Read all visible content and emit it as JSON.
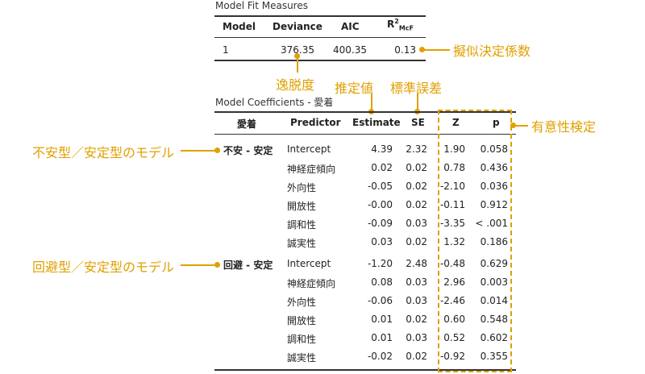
{
  "fit": {
    "title": "Model Fit Measures",
    "headers": {
      "model": "Model",
      "deviance": "Deviance",
      "aic": "AIC",
      "r2": "R",
      "r2_sup": "2",
      "r2_sub": "McF"
    },
    "row": {
      "model": "1",
      "deviance": "376.35",
      "aic": "400.35",
      "r2": "0.13"
    }
  },
  "coef": {
    "title": "Model Coefficients - 愛着",
    "headers": {
      "group": "愛着",
      "predictor": "Predictor",
      "estimate": "Estimate",
      "se": "SE",
      "z": "Z",
      "p": "p"
    },
    "groups": [
      {
        "label": "不安 - 安定",
        "rows": [
          {
            "predictor": "Intercept",
            "estimate": "4.39",
            "se": "2.32",
            "z": "1.90",
            "p": "0.058"
          },
          {
            "predictor": "神経症傾向",
            "estimate": "0.02",
            "se": "0.02",
            "z": "0.78",
            "p": "0.436"
          },
          {
            "predictor": "外向性",
            "estimate": "-0.05",
            "se": "0.02",
            "z": "-2.10",
            "p": "0.036"
          },
          {
            "predictor": "開放性",
            "estimate": "-0.00",
            "se": "0.02",
            "z": "-0.11",
            "p": "0.912"
          },
          {
            "predictor": "調和性",
            "estimate": "-0.09",
            "se": "0.03",
            "z": "-3.35",
            "p": "< .001"
          },
          {
            "predictor": "誠実性",
            "estimate": "0.03",
            "se": "0.02",
            "z": "1.32",
            "p": "0.186"
          }
        ]
      },
      {
        "label": "回避 - 安定",
        "rows": [
          {
            "predictor": "Intercept",
            "estimate": "-1.20",
            "se": "2.48",
            "z": "-0.48",
            "p": "0.629"
          },
          {
            "predictor": "神経症傾向",
            "estimate": "0.08",
            "se": "0.03",
            "z": "2.96",
            "p": "0.003"
          },
          {
            "predictor": "外向性",
            "estimate": "-0.06",
            "se": "0.03",
            "z": "-2.46",
            "p": "0.014"
          },
          {
            "predictor": "開放性",
            "estimate": "0.01",
            "se": "0.02",
            "z": "0.60",
            "p": "0.548"
          },
          {
            "predictor": "調和性",
            "estimate": "0.01",
            "se": "0.03",
            "z": "0.52",
            "p": "0.602"
          },
          {
            "predictor": "誠実性",
            "estimate": "-0.02",
            "se": "0.02",
            "z": "-0.92",
            "p": "0.355"
          }
        ]
      }
    ]
  },
  "annotations": {
    "pseudo_r2": "擬似決定係数",
    "deviance": "逸脱度",
    "estimate": "推定値",
    "se": "標準誤差",
    "significance": "有意性検定",
    "model1": "不安型／安定型のモデル",
    "model2": "回避型／安定型のモデル"
  },
  "colors": {
    "accent": "#e0a000",
    "text": "#222222",
    "rule": "#333333"
  }
}
